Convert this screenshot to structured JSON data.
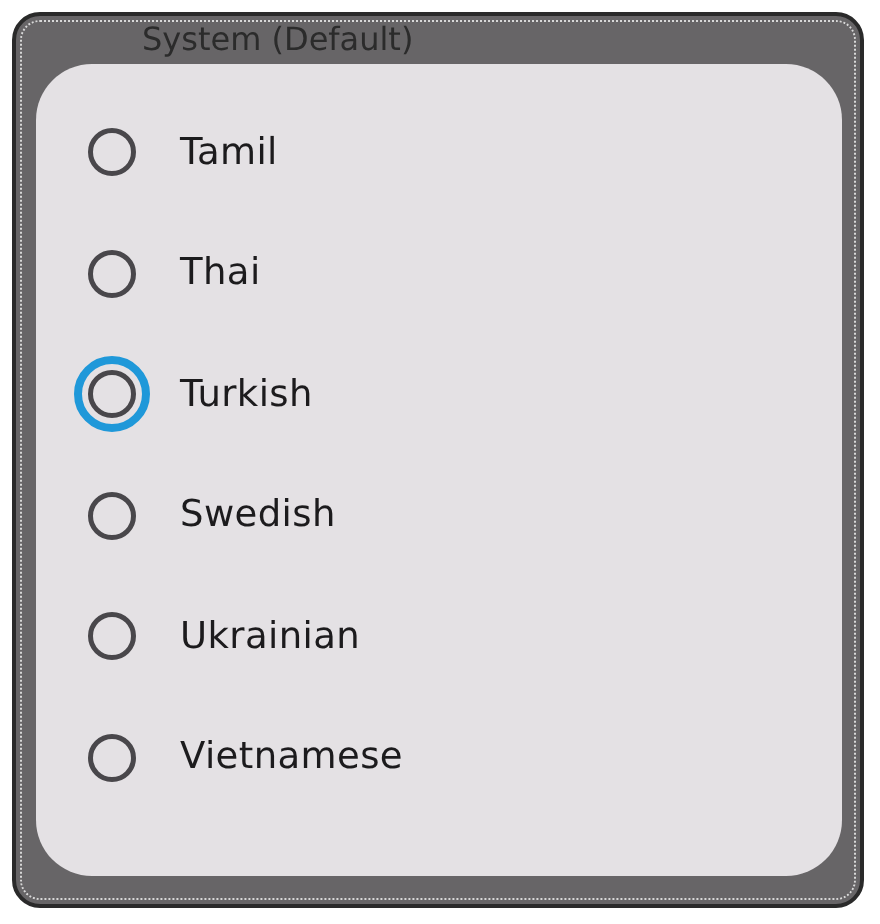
{
  "background": {
    "title": "System (Default)"
  },
  "dialog": {
    "options": [
      {
        "label": "Tamil",
        "focused": false
      },
      {
        "label": "Thai",
        "focused": false
      },
      {
        "label": "Turkish",
        "focused": true
      },
      {
        "label": "Swedish",
        "focused": false
      },
      {
        "label": "Ukrainian",
        "focused": false
      },
      {
        "label": "Vietnamese",
        "focused": false
      }
    ]
  }
}
